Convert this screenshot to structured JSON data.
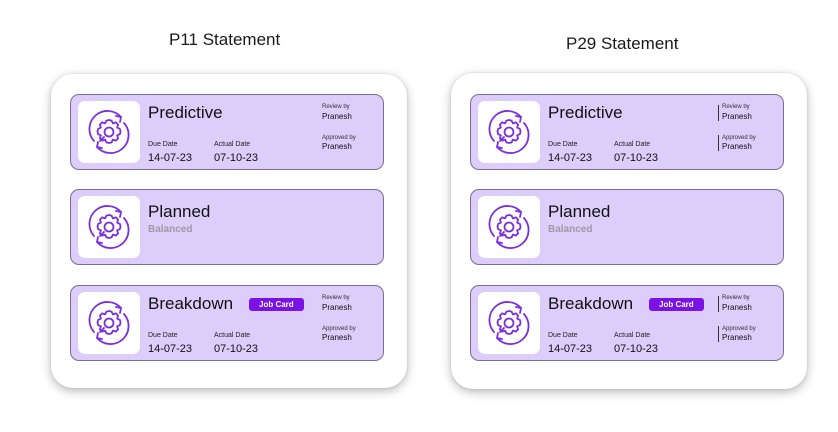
{
  "panels": [
    {
      "title": "P11 Statement",
      "cards": [
        {
          "icon": "maintenance-gear-icon",
          "title": "Predictive",
          "due_label": "Due Date",
          "due_date": "14-07-23",
          "actual_label": "Actual Date",
          "actual_date": "07-10-23",
          "review_label": "Review by",
          "review_name": "Pranesh",
          "approve_label": "Approved by",
          "approve_name": "Pranesh"
        },
        {
          "icon": "maintenance-gear-icon",
          "title": "Planned",
          "status": "Balanced"
        },
        {
          "icon": "maintenance-gear-icon",
          "title": "Breakdown",
          "badge": "Job Card",
          "due_label": "Due Date",
          "due_date": "14-07-23",
          "actual_label": "Actual Date",
          "actual_date": "07-10-23",
          "review_label": "Review by",
          "review_name": "Pranesh",
          "approve_label": "Approved by",
          "approve_name": "Pranesh"
        }
      ]
    },
    {
      "title": "P29 Statement",
      "cards": [
        {
          "icon": "maintenance-gear-icon",
          "title": "Predictive",
          "due_label": "Due Date",
          "due_date": "14-07-23",
          "actual_label": "Actual Date",
          "actual_date": "07-10-23",
          "review_label": "Review by",
          "review_name": "Pranesh",
          "approve_label": "Approved by",
          "approve_name": "Pranesh"
        },
        {
          "icon": "maintenance-gear-icon",
          "title": "Planned",
          "status": "Balanced"
        },
        {
          "icon": "maintenance-gear-icon",
          "title": "Breakdown",
          "badge": "Job Card",
          "due_label": "Due Date",
          "due_date": "14-07-23",
          "actual_label": "Actual Date",
          "actual_date": "07-10-23",
          "review_label": "Review by",
          "review_name": "Pranesh",
          "approve_label": "Approved by",
          "approve_name": "Pranesh"
        }
      ]
    }
  ],
  "colors": {
    "card_bg": "#dccdfb",
    "accent": "#7a12e8",
    "icon_stroke": "#7b2fe0",
    "status_text": "#9d9a9f"
  }
}
